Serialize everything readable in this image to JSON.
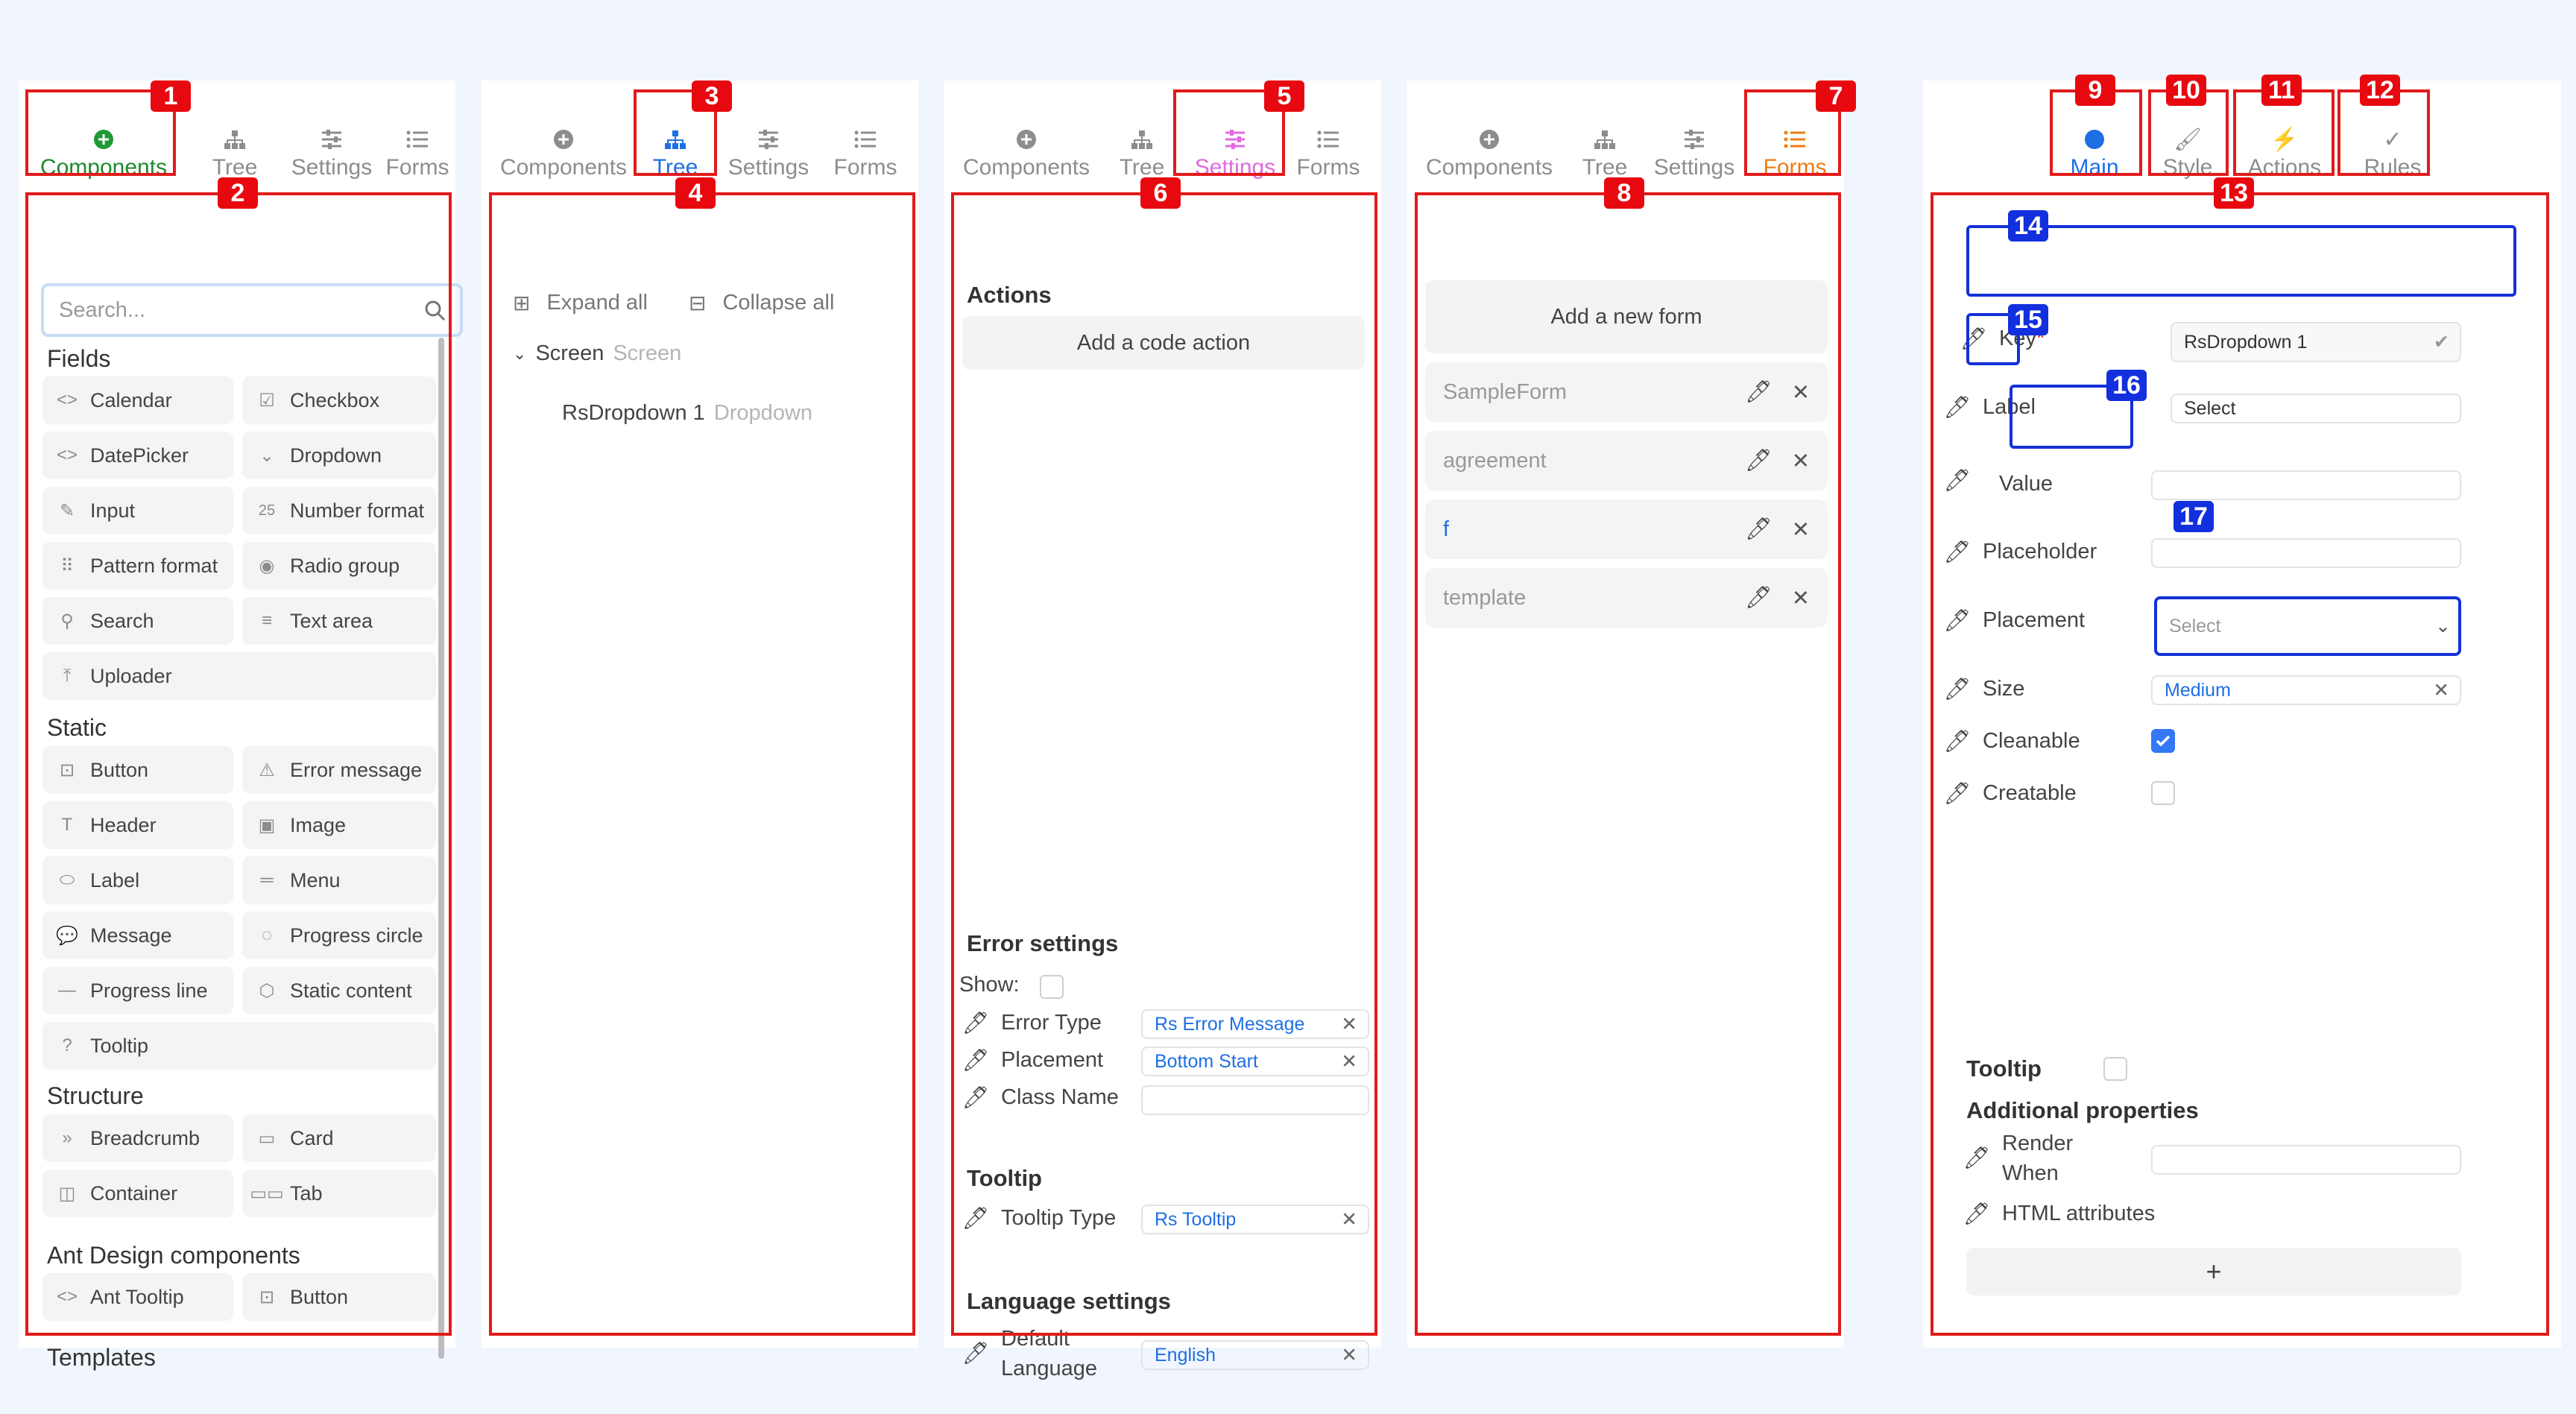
{
  "tabs": {
    "components": "Components",
    "tree": "Tree",
    "settings": "Settings",
    "forms": "Forms"
  },
  "badges": [
    "1",
    "2",
    "3",
    "4",
    "5",
    "6",
    "7",
    "8",
    "9",
    "10",
    "11",
    "12",
    "13",
    "14",
    "15",
    "16",
    "17"
  ],
  "palette": {
    "search_placeholder": "Search...",
    "fields_title": "Fields",
    "fields": [
      "Calendar",
      "Checkbox",
      "DatePicker",
      "Dropdown",
      "Input",
      "Number format",
      "Pattern format",
      "Radio group",
      "Search",
      "Text area",
      "Uploader"
    ],
    "static_title": "Static",
    "static": [
      "Button",
      "Error message",
      "Header",
      "Image",
      "Label",
      "Menu",
      "Message",
      "Progress circle",
      "Progress line",
      "Static content",
      "Tooltip"
    ],
    "structure_title": "Structure",
    "structure": [
      "Breadcrumb",
      "Card",
      "Container",
      "Tab"
    ],
    "ant_title": "Ant Design components",
    "ant": [
      "Ant Tooltip",
      "Button"
    ],
    "templates_title": "Templates"
  },
  "tree": {
    "expand_all": "Expand all",
    "collapse_all": "Collapse all",
    "screen_label": "Screen",
    "screen_type": "Screen",
    "node_label": "RsDropdown 1",
    "node_type": "Dropdown"
  },
  "settings": {
    "actions_title": "Actions",
    "add_code_action": "Add a code action",
    "error_title": "Error settings",
    "show_label": "Show:",
    "error_type_label": "Error Type",
    "error_type_value": "Rs Error Message",
    "placement_label": "Placement",
    "placement_value": "Bottom Start",
    "classname_label": "Class Name",
    "tooltip_title": "Tooltip",
    "tooltip_type_label": "Tooltip Type",
    "tooltip_type_value": "Rs Tooltip",
    "language_title": "Language settings",
    "default_language_label_1": "Default",
    "default_language_label_2": "Language",
    "default_language_value": "English"
  },
  "forms": {
    "add_new": "Add a new form",
    "items": [
      "SampleForm",
      "agreement",
      "f",
      "template"
    ]
  },
  "props": {
    "tabs": {
      "main": "Main",
      "style": "Style",
      "actions": "Actions",
      "rules": "Rules"
    },
    "key_label": "Key",
    "key_required": "*",
    "key_value": "RsDropdown 1",
    "label_label": "Label",
    "label_value": "Select",
    "value_label": "Value",
    "placeholder_label": "Placeholder",
    "placement_label": "Placement",
    "placement_value": "Select",
    "size_label": "Size",
    "size_value": "Medium",
    "cleanable_label": "Cleanable",
    "creatable_label": "Creatable",
    "tooltip_label": "Tooltip",
    "additional_title": "Additional properties",
    "render_when_1": "Render",
    "render_when_2": "When",
    "html_attributes_label": "HTML attributes",
    "add_symbol": "+"
  }
}
